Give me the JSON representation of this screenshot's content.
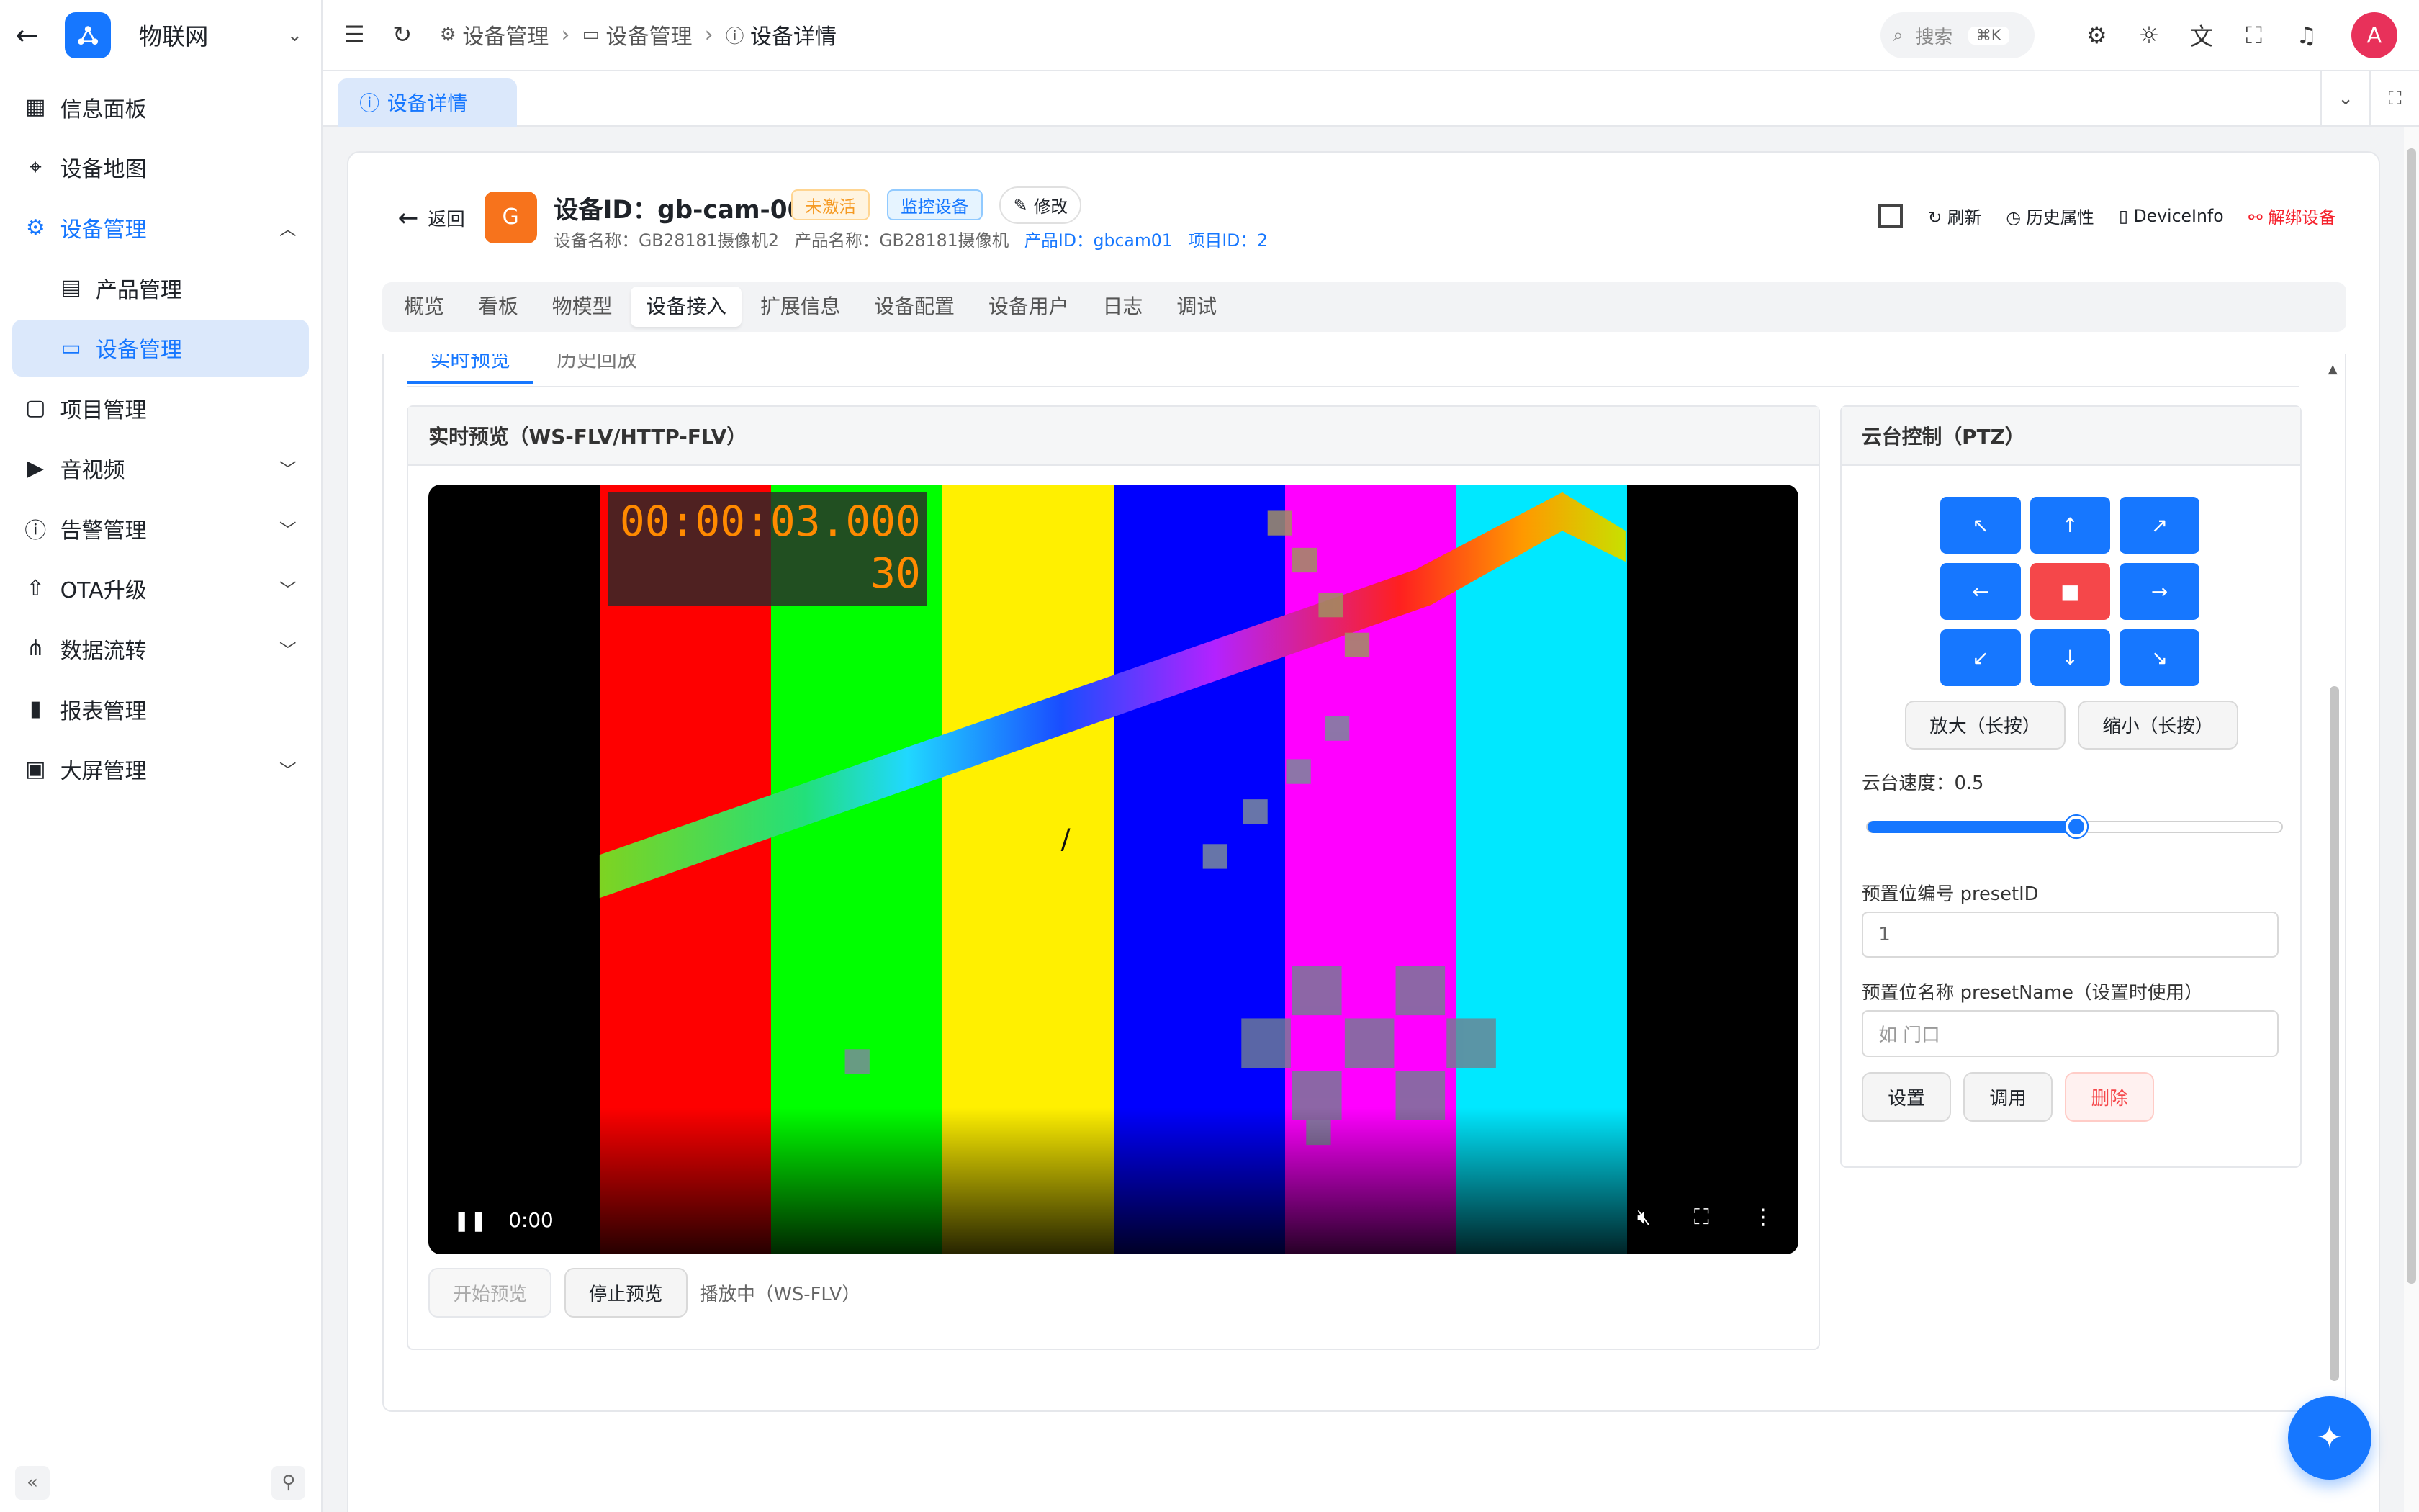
{
  "app": {
    "title": "物联网"
  },
  "sidebar": {
    "items": [
      {
        "label": "信息面板",
        "icon": "dashboard-icon"
      },
      {
        "label": "设备地图",
        "icon": "map-icon"
      },
      {
        "label": "设备管理",
        "icon": "chip-icon",
        "expanded": true
      },
      {
        "label": "产品管理",
        "icon": "product-icon"
      },
      {
        "label": "设备管理",
        "icon": "device-icon",
        "active": true
      },
      {
        "label": "项目管理",
        "icon": "briefcase-icon"
      },
      {
        "label": "音视频",
        "icon": "video-icon"
      },
      {
        "label": "告警管理",
        "icon": "alert-icon"
      },
      {
        "label": "OTA升级",
        "icon": "upload-icon"
      },
      {
        "label": "数据流转",
        "icon": "flow-icon"
      },
      {
        "label": "报表管理",
        "icon": "report-icon"
      },
      {
        "label": "大屏管理",
        "icon": "monitor-icon"
      }
    ]
  },
  "breadcrumb": {
    "items": [
      "设备管理",
      "设备管理",
      "设备详情"
    ]
  },
  "search": {
    "placeholder": "搜索",
    "shortcut": "⌘K"
  },
  "user": {
    "avatar": "A"
  },
  "page_tab": {
    "label": "设备详情"
  },
  "device": {
    "back": "返回",
    "avatar_letter": "G",
    "title": "设备ID：gb-cam-001",
    "status_tag": "未激活",
    "type_tag": "监控设备",
    "edit": "修改",
    "meta_name": "设备名称：GB28181摄像机2",
    "meta_product": "产品名称：GB28181摄像机",
    "meta_product_id": "产品ID：gbcam01",
    "meta_project_id": "项目ID：2",
    "actions": {
      "refresh": "刷新",
      "history": "历史属性",
      "info": "DeviceInfo",
      "unbind": "解绑设备"
    }
  },
  "tabs": [
    "概览",
    "看板",
    "物模型",
    "设备接入",
    "扩展信息",
    "设备配置",
    "设备用户",
    "日志",
    "调试"
  ],
  "subtabs": [
    "实时预览",
    "历史回放"
  ],
  "preview": {
    "title": "实时预览（WS-FLV/HTTP-FLV）",
    "timecode": "00:00:03.000",
    "fps": "30",
    "time": "0:00",
    "start": "开始预览",
    "stop": "停止预览",
    "status": "播放中（WS-FLV）",
    "colors": [
      "#000000",
      "#fe0000",
      "#00ff00",
      "#fff000",
      "#0000fe",
      "#ff00ff",
      "#00e8ff",
      "#000000"
    ]
  },
  "ptz": {
    "title": "云台控制（PTZ）",
    "buttons": [
      "↖",
      "↑",
      "↗",
      "←",
      "■",
      "→",
      "↙",
      "↓",
      "↘"
    ],
    "zoom_in": "放大（长按）",
    "zoom_out": "缩小（长按）",
    "speed_label": "云台速度：0.5",
    "speed": 0.5,
    "preset_id_label": "预置位编号 presetID",
    "preset_id_value": "1",
    "preset_name_label": "预置位名称 presetName（设置时使用）",
    "preset_name_placeholder": "如 门口",
    "set": "设置",
    "call": "调用",
    "delete": "删除"
  },
  "colors": {
    "primary": "#1677ff",
    "danger": "#f5474a",
    "warn": "#f59a23"
  }
}
